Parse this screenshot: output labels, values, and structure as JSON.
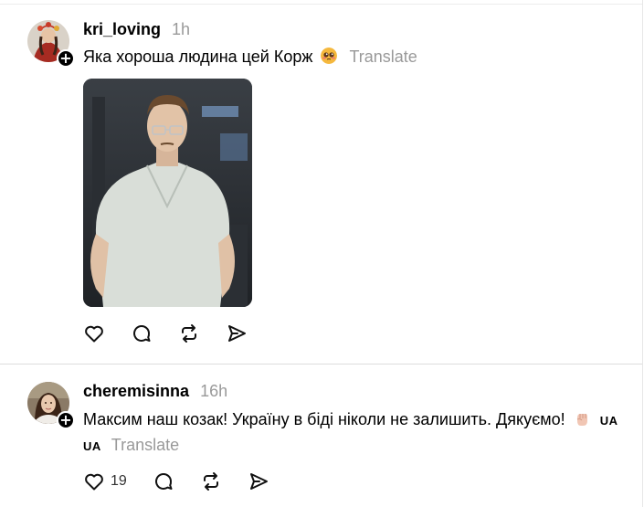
{
  "posts": [
    {
      "username": "kri_loving",
      "time": "1h",
      "text": "Яка хороша людина цей Корж",
      "emoji_icon": "pleading-face-emoji",
      "translate_label": "Translate",
      "media": "gif-man-in-glasses-white-polo",
      "actions": {
        "like": "heart-icon",
        "reply": "comment-icon",
        "repost": "repost-icon",
        "share": "share-icon"
      }
    },
    {
      "username": "cheremisinna",
      "time": "16h",
      "text": "Максим наш козак! Україну в біді ніколи не залишить. Дякуємо!",
      "emoji_icon": "raised-fist-emoji",
      "flag_label": "UA",
      "flag_label_2": "UA",
      "translate_label": "Translate",
      "like_count": "19",
      "actions": {
        "like": "heart-icon",
        "reply": "comment-icon",
        "repost": "repost-icon",
        "share": "share-icon"
      }
    }
  ],
  "colors": {
    "secondary_text": "#999999",
    "divider": "#dcdcdc"
  }
}
